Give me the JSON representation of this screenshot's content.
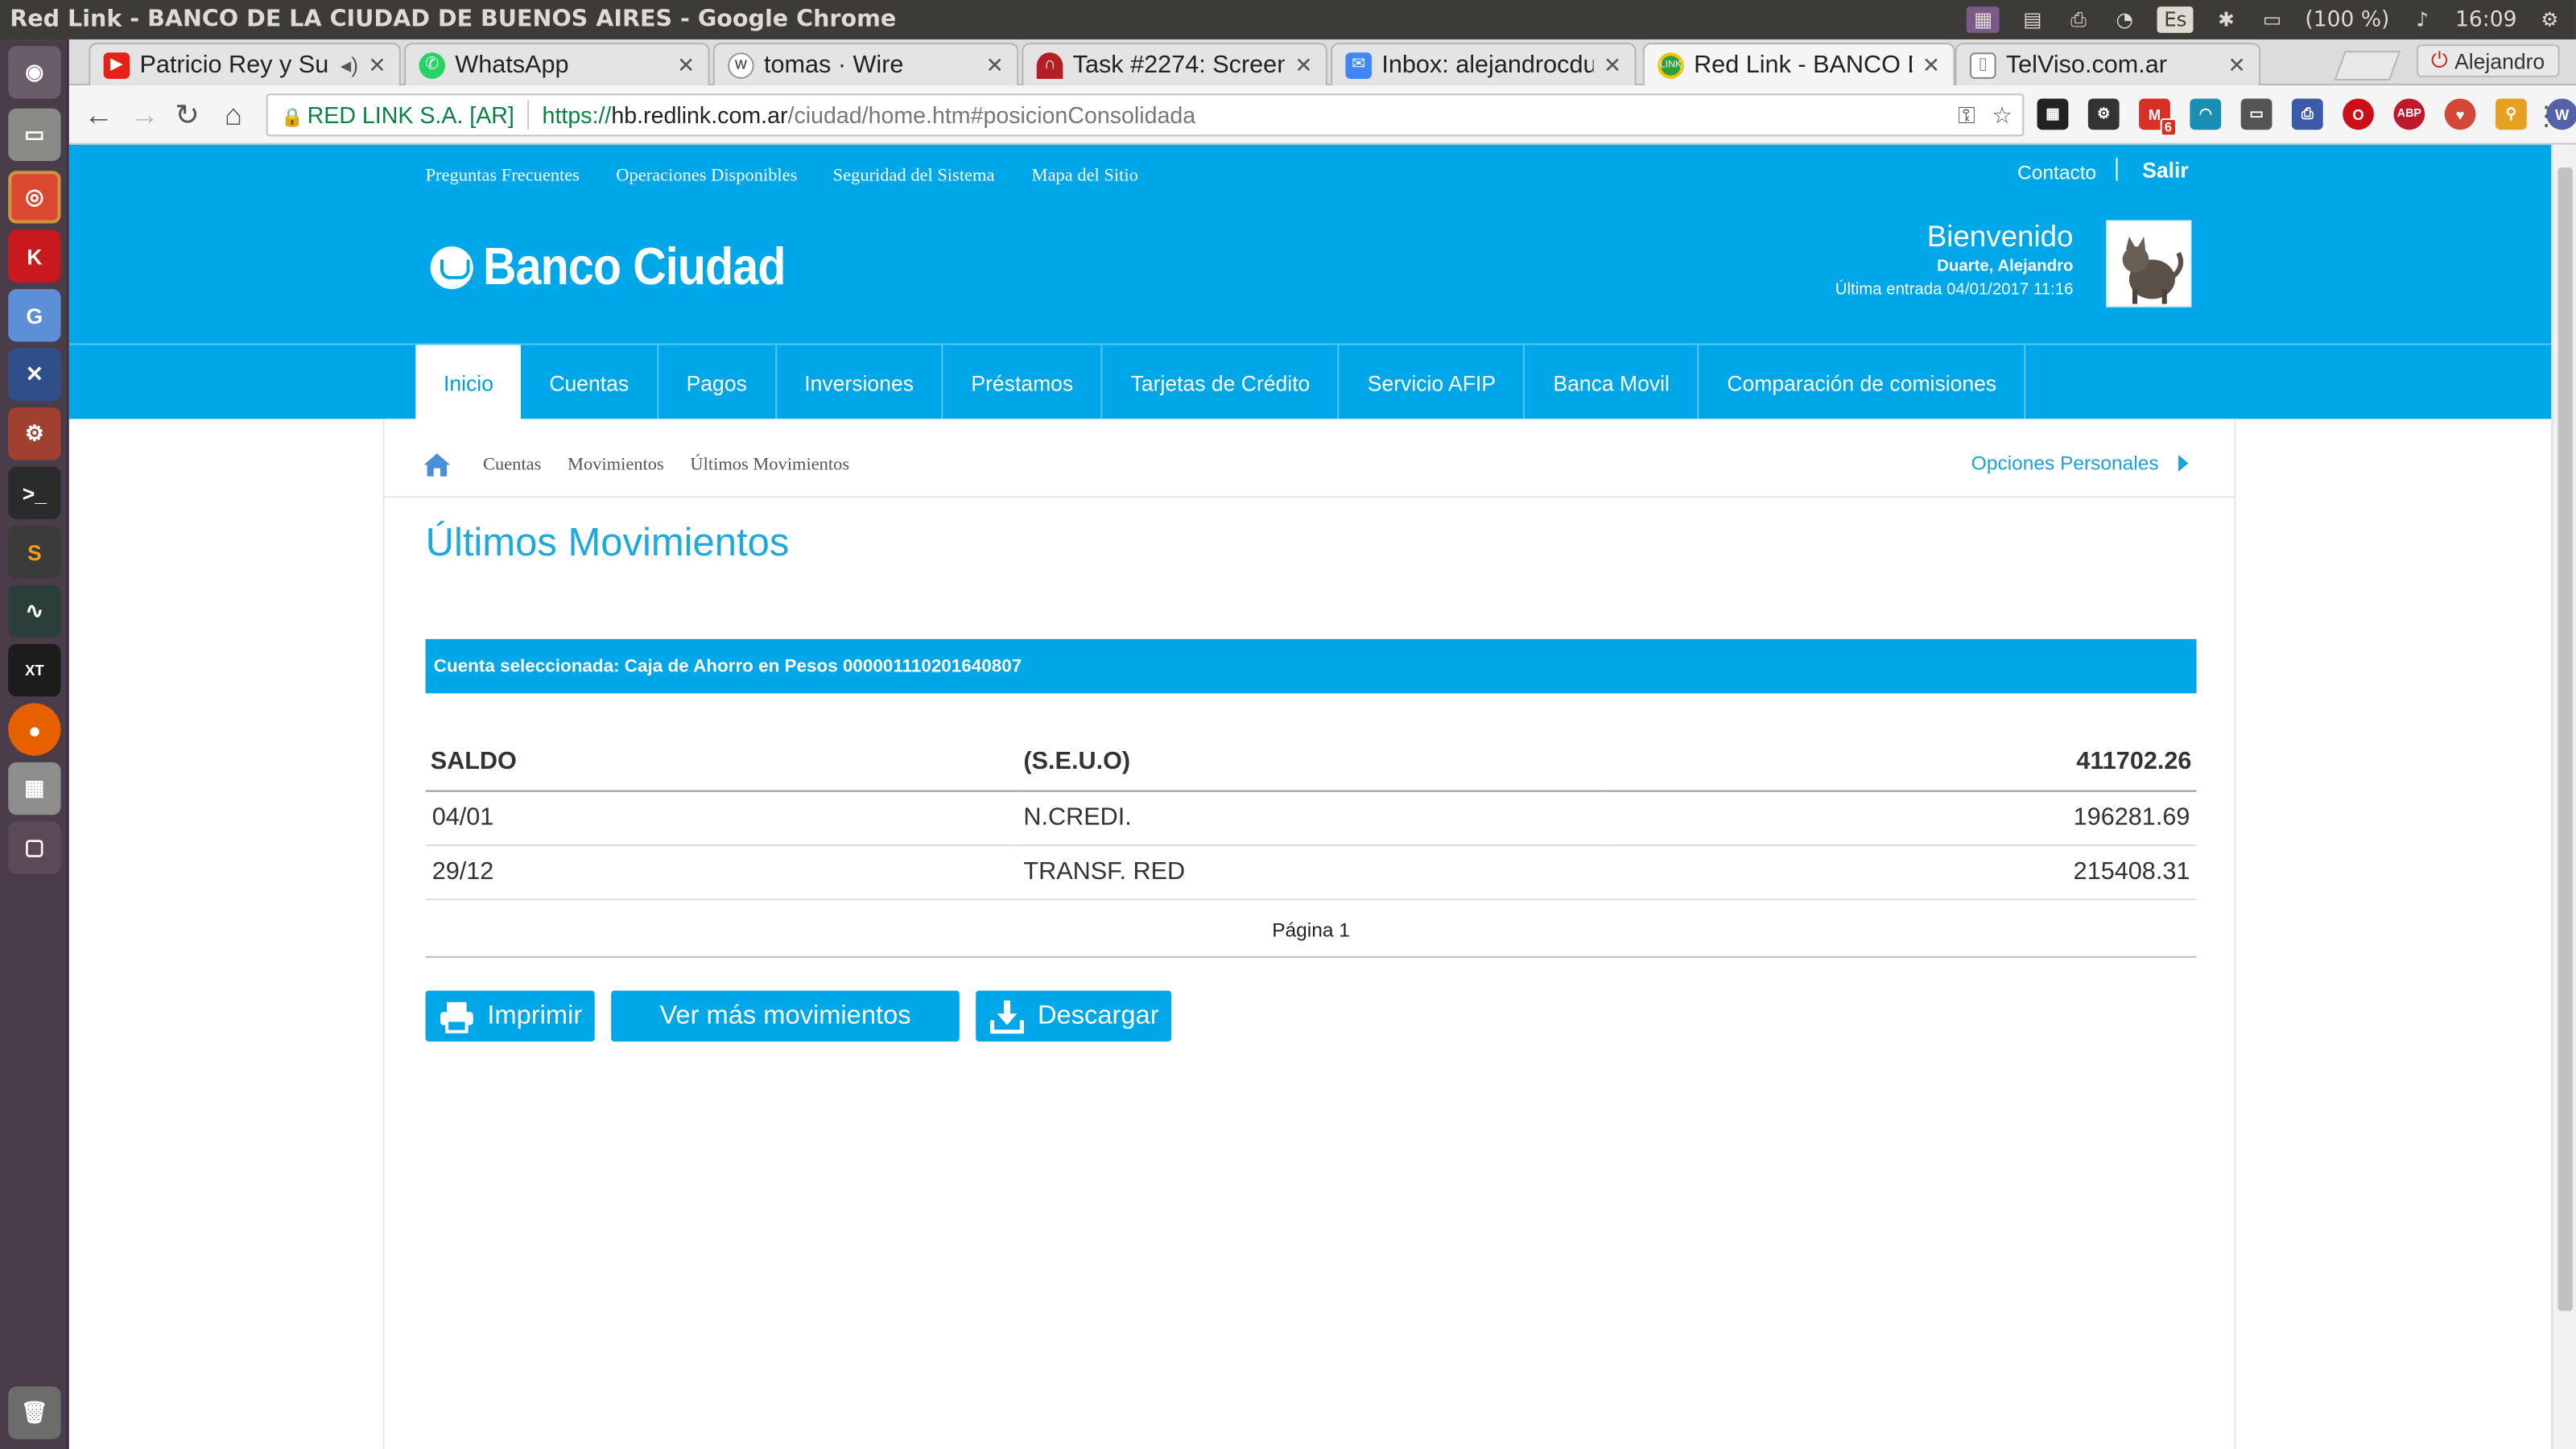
{
  "os": {
    "window_title": "Red Link - BANCO DE LA CIUDAD DE BUENOS AIRES - Google Chrome",
    "battery": "(100 %)",
    "clock": "16:09",
    "keyboard_lang": "Es"
  },
  "browser": {
    "tabs": [
      {
        "label": "Patricio Rey y Su",
        "icon": "youtube-icon",
        "color": "#e62117"
      },
      {
        "label": "WhatsApp",
        "icon": "whatsapp-icon",
        "color": "#25d366"
      },
      {
        "label": "tomas · Wire",
        "icon": "wire-icon",
        "color": "#555555"
      },
      {
        "label": "Task #2274: Screen",
        "icon": "redmine-icon",
        "color": "#b32024"
      },
      {
        "label": "Inbox: alejandrocdu",
        "icon": "inbox-icon",
        "color": "#4285f4"
      },
      {
        "label": "Red Link - BANCO D",
        "icon": "redlink-icon",
        "color": "#2e9e3e"
      },
      {
        "label": "TelViso.com.ar",
        "icon": "page-icon",
        "color": "#888888"
      }
    ],
    "active_tab": 5,
    "profile_name": "Alejandro",
    "secure_label": "RED LINK S.A. [AR]",
    "url_scheme": "https://",
    "url_host": "hb.redlink.com.ar",
    "url_path": "/ciudad/home.htm#posicionConsolidada",
    "gmail_badge": "6"
  },
  "bank": {
    "top_links": [
      "Preguntas Frecuentes",
      "Operaciones Disponibles",
      "Seguridad del Sistema",
      "Mapa del Sitio"
    ],
    "contacto": "Contacto",
    "salir": "Salir",
    "logo_text": "Banco Ciudad",
    "welcome_title": "Bienvenido",
    "user_name": "Duarte, Alejandro",
    "last_login": "Última entrada 04/01/2017 11:16",
    "nav": [
      "Inicio",
      "Cuentas",
      "Pagos",
      "Inversiones",
      "Préstamos",
      "Tarjetas de Crédito",
      "Servicio AFIP",
      "Banca Movil",
      "Comparación de comisiones"
    ],
    "nav_active": "Inicio",
    "breadcrumb": [
      "Cuentas",
      "Movimientos",
      "Últimos Movimientos"
    ],
    "personal_options": "Opciones Personales",
    "page_title": "Últimos Movimientos",
    "account_label": "Cuenta seleccionada: Caja de Ahorro en Pesos 000001110201640807",
    "table": {
      "header": {
        "col1": "SALDO",
        "col2": "(S.E.U.O)",
        "col3": "411702.26"
      },
      "rows": [
        {
          "date": "04/01",
          "desc": "N.CREDI.",
          "amount": "196281.69"
        },
        {
          "date": "29/12",
          "desc": "TRANSF. RED",
          "amount": "215408.31"
        }
      ]
    },
    "pagination": "Página 1",
    "buttons": {
      "print": "Imprimir",
      "more": "Ver más movimientos",
      "download": "Descargar"
    },
    "colors": {
      "brand": "#00a7e8",
      "title": "#1da8de"
    }
  }
}
